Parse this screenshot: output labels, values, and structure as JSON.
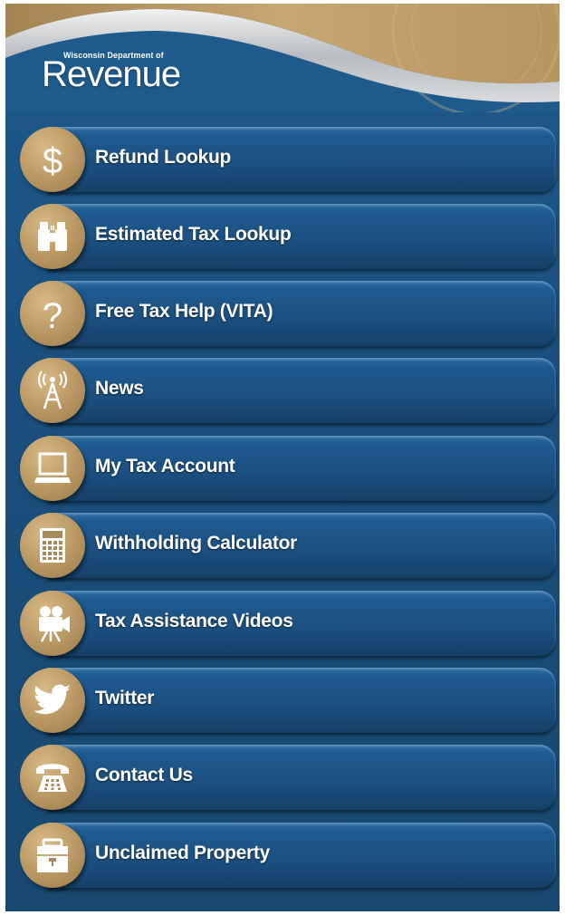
{
  "header": {
    "logo_small": "Wisconsin Department of",
    "logo_big": "Revenue"
  },
  "colors": {
    "background": "#1a4f7d",
    "button_bar": "#1b4f80",
    "icon_circle": "#b89662",
    "text": "#ffffff"
  },
  "menu": {
    "items": [
      {
        "label": "Refund Lookup",
        "icon": "dollar-icon"
      },
      {
        "label": "Estimated Tax Lookup",
        "icon": "binoculars-icon"
      },
      {
        "label": "Free Tax Help (VITA)",
        "icon": "question-mark-icon"
      },
      {
        "label": "News",
        "icon": "broadcast-tower-icon"
      },
      {
        "label": "My Tax Account",
        "icon": "laptop-icon"
      },
      {
        "label": "Withholding Calculator",
        "icon": "calculator-icon"
      },
      {
        "label": "Tax Assistance Videos",
        "icon": "video-camera-icon"
      },
      {
        "label": "Twitter",
        "icon": "twitter-bird-icon"
      },
      {
        "label": "Contact Us",
        "icon": "telephone-icon"
      },
      {
        "label": "Unclaimed Property",
        "icon": "safe-deposit-box-icon"
      }
    ]
  }
}
